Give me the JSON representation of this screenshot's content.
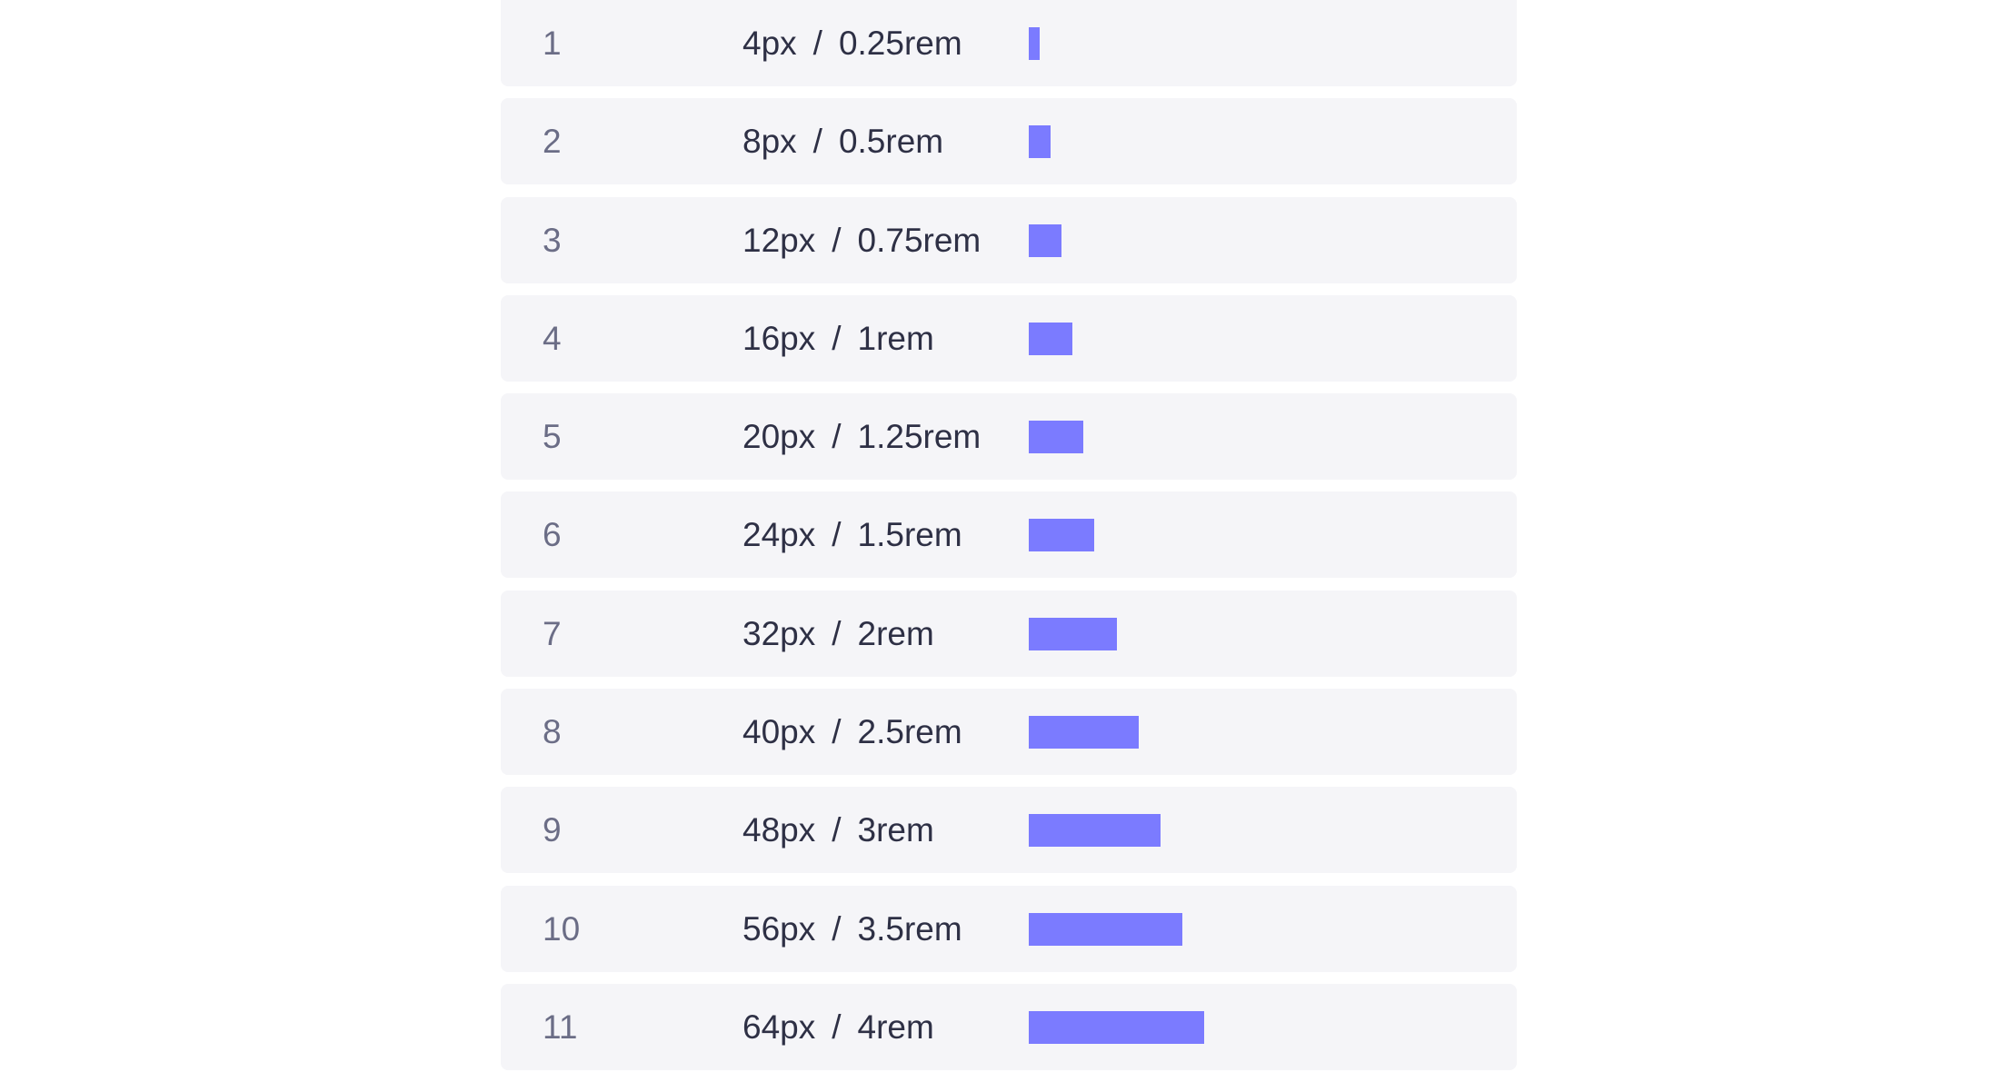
{
  "colors": {
    "row_background": "#f5f5f8",
    "bar": "#7b7bff",
    "step_text": "#6b6d86",
    "size_text": "#2e3045"
  },
  "scale": [
    {
      "step": "1",
      "px": "4px",
      "rem": "0.25rem",
      "value": 4
    },
    {
      "step": "2",
      "px": "8px",
      "rem": "0.5rem",
      "value": 8
    },
    {
      "step": "3",
      "px": "12px",
      "rem": "0.75rem",
      "value": 12
    },
    {
      "step": "4",
      "px": "16px",
      "rem": "1rem",
      "value": 16
    },
    {
      "step": "5",
      "px": "20px",
      "rem": "1.25rem",
      "value": 20
    },
    {
      "step": "6",
      "px": "24px",
      "rem": "1.5rem",
      "value": 24
    },
    {
      "step": "7",
      "px": "32px",
      "rem": "2rem",
      "value": 32
    },
    {
      "step": "8",
      "px": "40px",
      "rem": "2.5rem",
      "value": 40
    },
    {
      "step": "9",
      "px": "48px",
      "rem": "3rem",
      "value": 48
    },
    {
      "step": "10",
      "px": "56px",
      "rem": "3.5rem",
      "value": 56
    },
    {
      "step": "11",
      "px": "64px",
      "rem": "4rem",
      "value": 64
    }
  ],
  "separator": "/"
}
